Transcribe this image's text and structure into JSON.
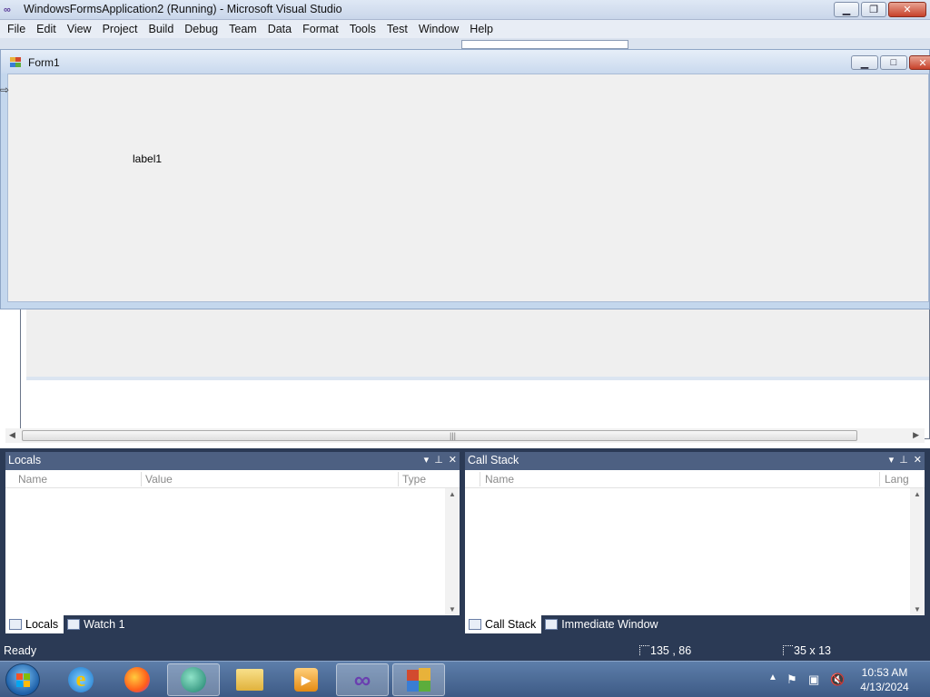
{
  "vs_window": {
    "title": "WindowsFormsApplication2 (Running) - Microsoft Visual Studio",
    "menu": [
      "File",
      "Edit",
      "View",
      "Project",
      "Build",
      "Debug",
      "Team",
      "Data",
      "Format",
      "Tools",
      "Test",
      "Window",
      "Help"
    ]
  },
  "form1": {
    "title": "Form1",
    "label_text": "label1"
  },
  "locals_window": {
    "title": "Locals",
    "columns": [
      "Name",
      "Value",
      "Type"
    ],
    "tabs": [
      "Locals",
      "Watch 1"
    ]
  },
  "callstack_window": {
    "title": "Call Stack",
    "columns": [
      "Name",
      "Lang"
    ],
    "tabs": [
      "Call Stack",
      "Immediate Window"
    ]
  },
  "status_bar": {
    "status": "Ready",
    "position": "135 , 86",
    "size": "35 x 13"
  },
  "taskbar": {
    "items": [
      "internet-explorer-icon",
      "firefox-icon",
      "app-icon",
      "file-explorer-icon",
      "media-player-icon",
      "visual-studio-icon",
      "form-app-icon"
    ],
    "clock_time": "10:53 AM",
    "clock_date": "4/13/2024"
  },
  "colors": {
    "ide_dark": "#2b3a55",
    "tool_header": "#4d6082",
    "form_client": "#f0f0f0",
    "close_red": "#c7412a"
  }
}
